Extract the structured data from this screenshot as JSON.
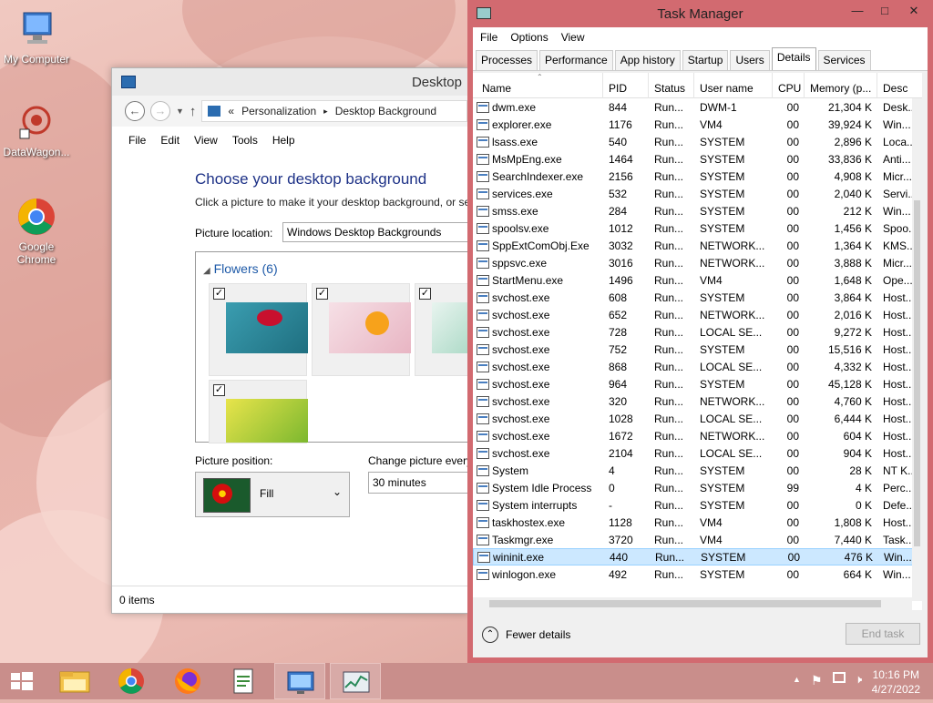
{
  "desktop": {
    "icons": [
      {
        "label": "My Computer"
      },
      {
        "label": "DataWagon..."
      },
      {
        "label": "Google Chrome"
      }
    ]
  },
  "explorer": {
    "title": "Desktop",
    "breadcrumb": [
      "Personalization",
      "Desktop Background"
    ],
    "breadcrumb_sep": "«",
    "menu": [
      "File",
      "Edit",
      "View",
      "Tools",
      "Help"
    ],
    "heading": "Choose your desktop background",
    "instruction": "Click a picture to make it your desktop background, or se",
    "picture_location_label": "Picture location:",
    "picture_location_value": "Windows Desktop Backgrounds",
    "group_label": "Flowers (6)",
    "picture_position_label": "Picture position:",
    "picture_position_value": "Fill",
    "change_picture_label": "Change picture every",
    "change_picture_value": "30 minutes",
    "status": "0 items"
  },
  "taskmgr": {
    "title": "Task Manager",
    "menu": [
      "File",
      "Options",
      "View"
    ],
    "tabs": [
      "Processes",
      "Performance",
      "App history",
      "Startup",
      "Users",
      "Details",
      "Services"
    ],
    "active_tab": "Details",
    "columns": [
      "Name",
      "PID",
      "Status",
      "User name",
      "CPU",
      "Memory (p...",
      "Desc"
    ],
    "rows": [
      [
        "dwm.exe",
        "844",
        "Run...",
        "DWM-1",
        "00",
        "21,304 K",
        "Desk..."
      ],
      [
        "explorer.exe",
        "1176",
        "Run...",
        "VM4",
        "00",
        "39,924 K",
        "Win..."
      ],
      [
        "lsass.exe",
        "540",
        "Run...",
        "SYSTEM",
        "00",
        "2,896 K",
        "Loca..."
      ],
      [
        "MsMpEng.exe",
        "1464",
        "Run...",
        "SYSTEM",
        "00",
        "33,836 K",
        "Anti..."
      ],
      [
        "SearchIndexer.exe",
        "2156",
        "Run...",
        "SYSTEM",
        "00",
        "4,908 K",
        "Micr..."
      ],
      [
        "services.exe",
        "532",
        "Run...",
        "SYSTEM",
        "00",
        "2,040 K",
        "Servi..."
      ],
      [
        "smss.exe",
        "284",
        "Run...",
        "SYSTEM",
        "00",
        "212 K",
        "Win..."
      ],
      [
        "spoolsv.exe",
        "1012",
        "Run...",
        "SYSTEM",
        "00",
        "1,456 K",
        "Spoo..."
      ],
      [
        "SppExtComObj.Exe",
        "3032",
        "Run...",
        "NETWORK...",
        "00",
        "1,364 K",
        "KMS..."
      ],
      [
        "sppsvc.exe",
        "3016",
        "Run...",
        "NETWORK...",
        "00",
        "3,888 K",
        "Micr..."
      ],
      [
        "StartMenu.exe",
        "1496",
        "Run...",
        "VM4",
        "00",
        "1,648 K",
        "Ope..."
      ],
      [
        "svchost.exe",
        "608",
        "Run...",
        "SYSTEM",
        "00",
        "3,864 K",
        "Host..."
      ],
      [
        "svchost.exe",
        "652",
        "Run...",
        "NETWORK...",
        "00",
        "2,016 K",
        "Host..."
      ],
      [
        "svchost.exe",
        "728",
        "Run...",
        "LOCAL SE...",
        "00",
        "9,272 K",
        "Host..."
      ],
      [
        "svchost.exe",
        "752",
        "Run...",
        "SYSTEM",
        "00",
        "15,516 K",
        "Host..."
      ],
      [
        "svchost.exe",
        "868",
        "Run...",
        "LOCAL SE...",
        "00",
        "4,332 K",
        "Host..."
      ],
      [
        "svchost.exe",
        "964",
        "Run...",
        "SYSTEM",
        "00",
        "45,128 K",
        "Host..."
      ],
      [
        "svchost.exe",
        "320",
        "Run...",
        "NETWORK...",
        "00",
        "4,760 K",
        "Host..."
      ],
      [
        "svchost.exe",
        "1028",
        "Run...",
        "LOCAL SE...",
        "00",
        "6,444 K",
        "Host..."
      ],
      [
        "svchost.exe",
        "1672",
        "Run...",
        "NETWORK...",
        "00",
        "604 K",
        "Host..."
      ],
      [
        "svchost.exe",
        "2104",
        "Run...",
        "LOCAL SE...",
        "00",
        "904 K",
        "Host..."
      ],
      [
        "System",
        "4",
        "Run...",
        "SYSTEM",
        "00",
        "28 K",
        "NT K..."
      ],
      [
        "System Idle Process",
        "0",
        "Run...",
        "SYSTEM",
        "99",
        "4 K",
        "Perc..."
      ],
      [
        "System interrupts",
        "-",
        "Run...",
        "SYSTEM",
        "00",
        "0 K",
        "Defe..."
      ],
      [
        "taskhostex.exe",
        "1128",
        "Run...",
        "VM4",
        "00",
        "1,808 K",
        "Host..."
      ],
      [
        "Taskmgr.exe",
        "3720",
        "Run...",
        "VM4",
        "00",
        "7,440 K",
        "Task..."
      ],
      [
        "wininit.exe",
        "440",
        "Run...",
        "SYSTEM",
        "00",
        "476 K",
        "Win..."
      ],
      [
        "winlogon.exe",
        "492",
        "Run...",
        "SYSTEM",
        "00",
        "664 K",
        "Win..."
      ]
    ],
    "selected_row": "wininit.exe",
    "fewer_details": "Fewer details",
    "end_task": "End task"
  },
  "taskbar": {
    "time": "10:16 PM",
    "date": "4/27/2022",
    "apps": [
      "file-explorer",
      "chrome",
      "firefox",
      "notepad",
      "control-panel",
      "task-manager"
    ]
  },
  "colors": {
    "accent": "#d26a70",
    "taskbar": "#c98e8b",
    "heading": "#1e3287"
  }
}
